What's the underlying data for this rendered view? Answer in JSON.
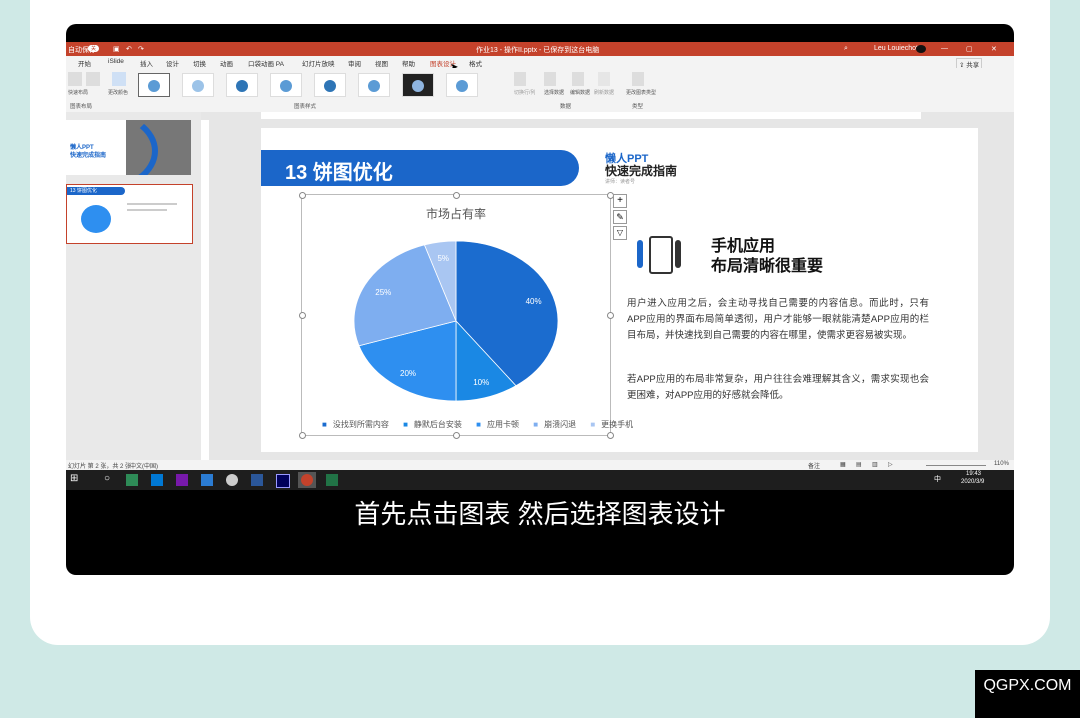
{
  "window": {
    "autosave_label": "自动保存",
    "autosave_state": "关",
    "doc_title": "作业13 - 操作II.pptx - 已保存到这台电脑",
    "user": "Leu Louiechot",
    "share_label": "共享"
  },
  "menu": {
    "tabs": [
      "开始",
      "iSlide",
      "插入",
      "设计",
      "切换",
      "动画",
      "口袋动画 PA",
      "幻灯片放映",
      "审阅",
      "视图",
      "帮助",
      "图表设计",
      "格式"
    ],
    "active": "图表设计"
  },
  "ribbon": {
    "groups": {
      "layout": "图表布局",
      "styles": "图表样式",
      "data": "数据",
      "type": "类型"
    },
    "buttons": {
      "add_element": "添加图表元素",
      "quick_layout": "快速布局",
      "change_colors": "更改颜色",
      "switch_row_col": "切换行/列",
      "select_data": "选择数据",
      "edit_data": "编辑数据",
      "refresh_data": "刷新数据",
      "change_type": "更改图表类型"
    }
  },
  "left_pane": {
    "slide1": {
      "line1": "懒人PPT",
      "line2": "快速完成指南"
    },
    "slide2": {
      "label": "13 饼图优化"
    }
  },
  "slide": {
    "heading": "13  饼图优化",
    "brand_line1": "懒人PPT",
    "brand_line2": "快速完成指南",
    "brand_line3": "讲师：读者号",
    "phone_title_1": "手机应用",
    "phone_title_2": "布局清晰很重要",
    "para1": "用户进入应用之后，会主动寻找自己需要的内容信息。而此时，只有APP应用的界面布局简单透彻，用户才能够一眼就能清楚APP应用的栏目布局，并快速找到自己需要的内容在哪里，使需求更容易被实现。",
    "para2": "若APP应用的布局非常复杂，用户往往会难理解其含义，需求实现也会更困难，对APP应用的好感就会降低。"
  },
  "chart_data": {
    "type": "pie",
    "title": "市场占有率",
    "categories": [
      "没找到所需内容",
      "静默后台安装",
      "应用卡顿",
      "崩溃闪退",
      "更换手机"
    ],
    "values": [
      40,
      10,
      20,
      25,
      5
    ],
    "labels": [
      "40%",
      "10%",
      "20%",
      "25%",
      "5%"
    ],
    "colors": [
      "#1b6ccf",
      "#1a88e4",
      "#2e8ff0",
      "#7eaef0",
      "#a9c6f2"
    ],
    "legend": "bottom"
  },
  "status": {
    "slide_info": "幻灯片 第 2 张，共 2 张",
    "language": "中文(中国)",
    "notes": "备注",
    "zoom": "110%"
  },
  "taskbar": {
    "time": "19:43",
    "date": "2020/3/9",
    "ime": "中"
  },
  "subtitle": "首先点击图表 然后选择图表设计",
  "watermark": "QGPX.COM"
}
